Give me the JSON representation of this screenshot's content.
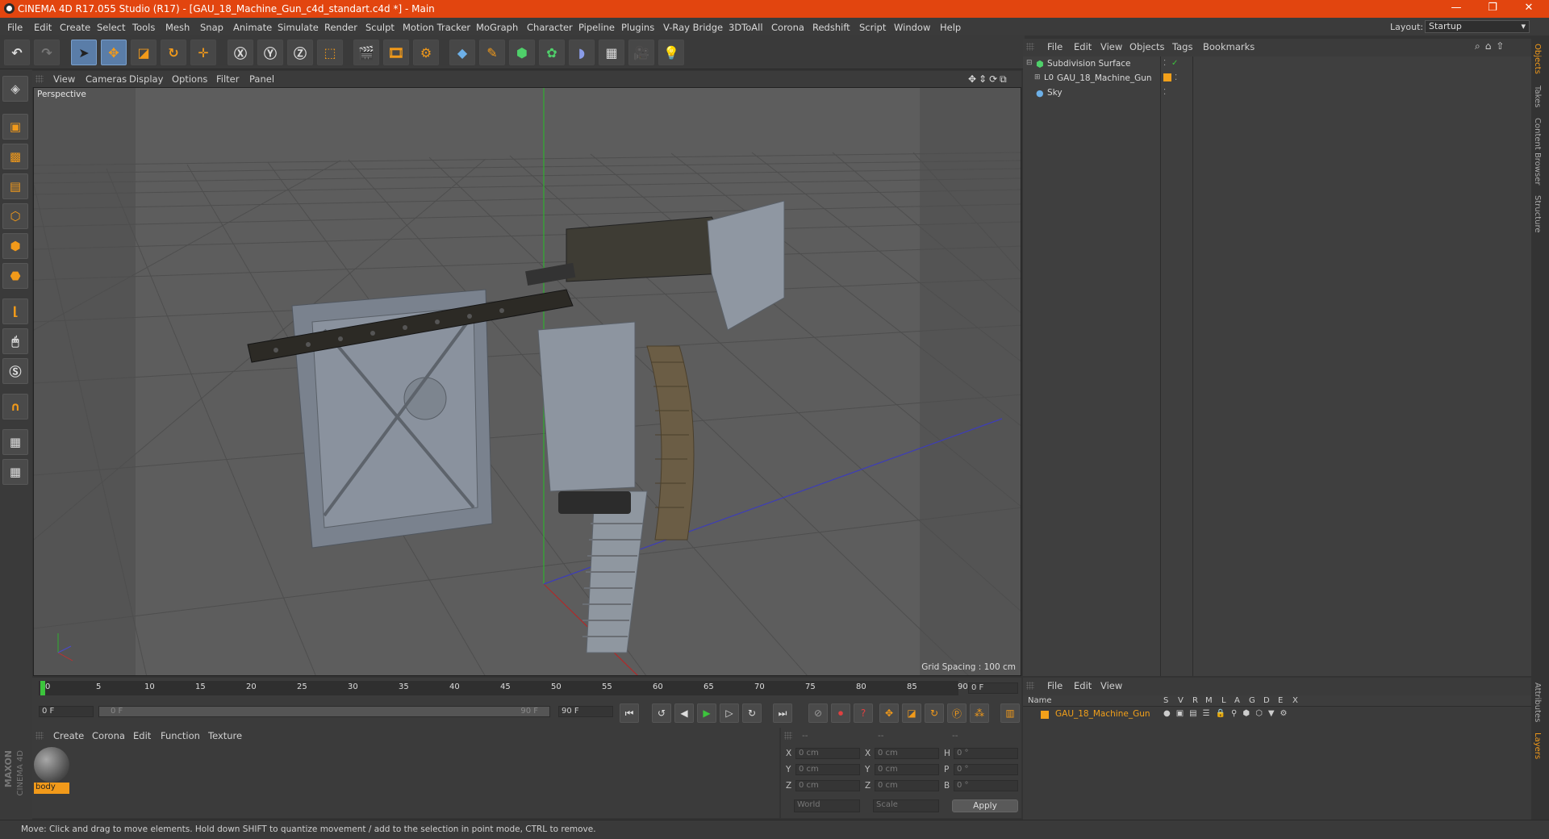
{
  "window": {
    "title": "CINEMA 4D R17.055 Studio (R17) - [GAU_18_Machine_Gun_c4d_standart.c4d *] - Main"
  },
  "menu": [
    "File",
    "Edit",
    "Create",
    "Select",
    "Tools",
    "Mesh",
    "Snap",
    "Animate",
    "Simulate",
    "Render",
    "Sculpt",
    "Motion Tracker",
    "MoGraph",
    "Character",
    "Pipeline",
    "Plugins",
    "V-Ray Bridge",
    "3DToAll",
    "Corona",
    "Redshift",
    "Script",
    "Window",
    "Help"
  ],
  "layout": {
    "label": "Layout:",
    "value": "Startup"
  },
  "viewport": {
    "menu": [
      "View",
      "Cameras",
      "Display",
      "Options",
      "Filter",
      "Panel"
    ],
    "camera_label": "Perspective",
    "grid_spacing": "Grid Spacing : 100 cm"
  },
  "timeline": {
    "ticks": [
      "0",
      "5",
      "10",
      "15",
      "20",
      "25",
      "30",
      "35",
      "40",
      "45",
      "50",
      "55",
      "60",
      "65",
      "70",
      "75",
      "80",
      "85",
      "90"
    ],
    "current_frame": "0 F",
    "start_field": "0 F",
    "range_start": "0 F",
    "range_end": "90 F",
    "end_field": "90 F"
  },
  "material_panel": {
    "menu": [
      "Create",
      "Corona",
      "Edit",
      "Function",
      "Texture"
    ],
    "materials": [
      {
        "name": "body"
      }
    ]
  },
  "coords": {
    "header": [
      "--",
      "--",
      "--"
    ],
    "rows": [
      {
        "a": "X",
        "av": "0 cm",
        "b": "X",
        "bv": "0 cm",
        "c": "H",
        "cv": "0 °"
      },
      {
        "a": "Y",
        "av": "0 cm",
        "b": "Y",
        "bv": "0 cm",
        "c": "P",
        "cv": "0 °"
      },
      {
        "a": "Z",
        "av": "0 cm",
        "b": "Z",
        "bv": "0 cm",
        "c": "B",
        "cv": "0 °"
      }
    ],
    "world": "World",
    "scale": "Scale",
    "apply": "Apply"
  },
  "objects_panel": {
    "menu": [
      "File",
      "Edit",
      "View",
      "Objects",
      "Tags",
      "Bookmarks"
    ],
    "items": [
      {
        "name": "Subdivision Surface",
        "indent": 0
      },
      {
        "name": "GAU_18_Machine_Gun",
        "indent": 1
      },
      {
        "name": "Sky",
        "indent": 0
      }
    ]
  },
  "layers_panel": {
    "menu": [
      "File",
      "Edit",
      "View"
    ],
    "columns": [
      "Name",
      "S",
      "V",
      "R",
      "M",
      "L",
      "A",
      "G",
      "D",
      "E",
      "X"
    ],
    "layer": "GAU_18_Machine_Gun"
  },
  "side_tabs": [
    "Objects",
    "Takes",
    "Content Browser",
    "Structure"
  ],
  "side_tabs_bottom": [
    "Attributes",
    "Layers"
  ],
  "brand": {
    "line1": "MAXON",
    "line2": "CINEMA 4D"
  },
  "status": "Move: Click and drag to move elements. Hold down SHIFT to quantize movement / add to the selection in point mode, CTRL to remove.",
  "colors": {
    "title_bar": "#e2450f",
    "accent": "#f29a1a",
    "selected": "#5a7da8"
  }
}
